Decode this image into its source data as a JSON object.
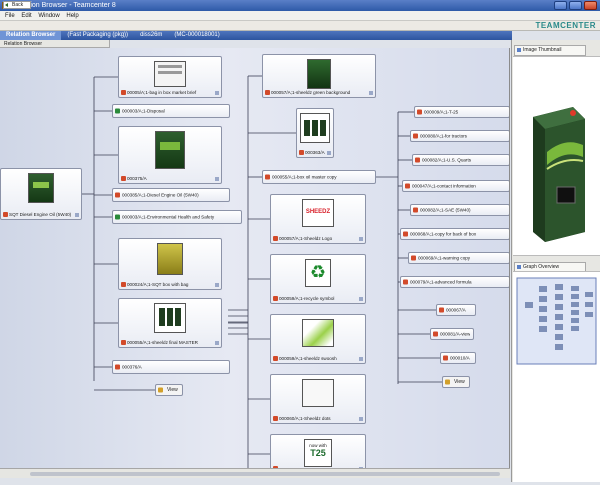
{
  "window": {
    "title": "Relation Browser - Teamcenter 8"
  },
  "menu": [
    "File",
    "Edit",
    "Window",
    "Help"
  ],
  "toolbar": {
    "back_label": "Back"
  },
  "brand": "TEAMCENTER",
  "tabs": [
    {
      "label": "Relation Browser",
      "active": true
    },
    {
      "label": "(Fast Packaging (pkg))",
      "active": false
    },
    {
      "label": "diss26m",
      "active": false
    },
    {
      "label": "(MC-000018001)",
      "active": false
    }
  ],
  "left_view_label": "Relation Browser",
  "root": {
    "label": "SQT Diesel Engine Oil (5W40)"
  },
  "col1": [
    {
      "label": "00005/A;1-bag in box market brief",
      "kind": "thumb"
    },
    {
      "label": "000003/A;1-Disposal",
      "kind": "chip"
    },
    {
      "label": "000375/A",
      "kind": "thumb"
    },
    {
      "label": "000385/A;1-Diesel Engine Oil (5W40)",
      "kind": "chip"
    },
    {
      "label": "000003/A;1-Environmental Health and Safety",
      "kind": "chip"
    },
    {
      "label": "000024/A;1-SQT box with bag",
      "kind": "thumb"
    },
    {
      "label": "000055/A;1-sheeldz final MASTER",
      "kind": "thumb"
    },
    {
      "label": "000376/A",
      "kind": "chip"
    }
  ],
  "col1_view": "View",
  "col2": [
    {
      "label": "000057/A;1-sheeldz green background",
      "kind": "thumb"
    },
    {
      "label": "000363/A",
      "kind": "thumb"
    },
    {
      "label": "000055/A;1-box oil master copy",
      "kind": "chip"
    },
    {
      "label": "000057/A;1-Sheeldz Logo",
      "kind": "thumb",
      "art": "SHEEDZ"
    },
    {
      "label": "000059/A;1-recycle symbol",
      "kind": "thumb"
    },
    {
      "label": "000059/A;1-sheeldz swoosh",
      "kind": "thumb"
    },
    {
      "label": "000060/A;1-Sheeldz dots",
      "kind": "thumb"
    },
    {
      "label": "",
      "kind": "thumb",
      "art_lines": [
        "now with",
        "T25"
      ]
    }
  ],
  "col3": [
    {
      "label": "000009/A;1-T-25"
    },
    {
      "label": "000080/A;1-for tractors"
    },
    {
      "label": "000082/A;1-U.S. Quarts"
    },
    {
      "label": "000047/A;1-contact information"
    },
    {
      "label": "000082/A;1-SAE (5W40)"
    },
    {
      "label": "000068/A;1-copy for back of box"
    },
    {
      "label": "000069/A;1-warning copy"
    },
    {
      "label": "000079/A;1-advanced formula"
    },
    {
      "label": "000067/A"
    },
    {
      "label": "000081/A-view"
    },
    {
      "label": "000010/A"
    }
  ],
  "col3_view": "View",
  "panels": {
    "thumbnail_title": "Image Thumbnail",
    "graph_title": "Graph Overview"
  },
  "colors": {
    "accent": "#2d549f",
    "brand": "#2a8a8a"
  }
}
